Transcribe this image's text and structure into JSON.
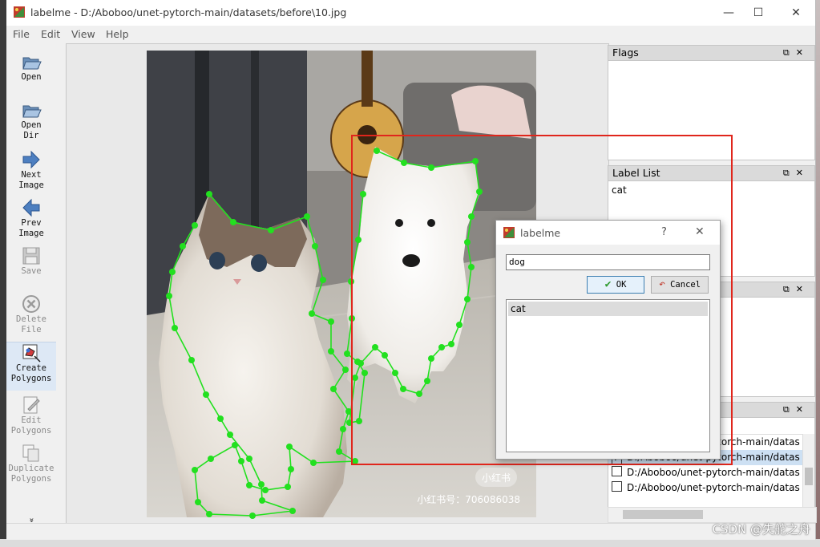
{
  "window": {
    "title": "labelme - D:/Aboboo/unet-pytorch-main/datasets/before\\10.jpg",
    "controls": [
      "—",
      "☐",
      "✕"
    ]
  },
  "menu": [
    "File",
    "Edit",
    "View",
    "Help"
  ],
  "toolbar": [
    {
      "label": "Open",
      "icon": "folder-open-icon",
      "enabled": true
    },
    {
      "label": "Open\nDir",
      "icon": "folder-open-dir-icon",
      "enabled": true
    },
    {
      "label": "Next\nImage",
      "icon": "arrow-right-icon",
      "enabled": true
    },
    {
      "label": "Prev\nImage",
      "icon": "arrow-left-icon",
      "enabled": true
    },
    {
      "label": "Save",
      "icon": "floppy-icon",
      "enabled": false
    },
    {
      "label": "Delete\nFile",
      "icon": "delete-icon",
      "enabled": false
    },
    {
      "label": "Create\nPolygons",
      "icon": "create-polygon-icon",
      "enabled": true
    },
    {
      "label": "Edit\nPolygons",
      "icon": "edit-polygon-icon",
      "enabled": false
    },
    {
      "label": "Duplicate\nPolygons",
      "icon": "duplicate-icon",
      "enabled": false
    },
    {
      "label": "»",
      "icon": "more-chevron-icon",
      "enabled": true
    }
  ],
  "docks": {
    "flags": {
      "title": "Flags",
      "items": []
    },
    "label_list": {
      "title": "Label List",
      "items": [
        "cat"
      ]
    },
    "file_list": {
      "items": [
        {
          "checked": false,
          "text": "D:/Aboboo/unet-pytorch-main/datas"
        },
        {
          "checked": true,
          "text": "D:/Aboboo/unet-pytorch-main/datas"
        },
        {
          "checked": false,
          "text": "D:/Aboboo/unet-pytorch-main/datas"
        },
        {
          "checked": false,
          "text": "D:/Aboboo/unet-pytorch-main/datas"
        }
      ]
    }
  },
  "dialog": {
    "title": "labelme",
    "help": "?",
    "close": "✕",
    "input_value": "dog",
    "ok_label": "OK",
    "cancel_label": "Cancel",
    "labels": [
      "cat"
    ]
  },
  "photo": {
    "watermark_badge": "小红书",
    "watermark_id": "小红书号：706086038"
  },
  "corner_watermark": "CSDN @失舵之舟",
  "colors": {
    "polygon": "#22e01f",
    "highlight_box": "#e0261c",
    "selected_row": "#cde0f3"
  }
}
